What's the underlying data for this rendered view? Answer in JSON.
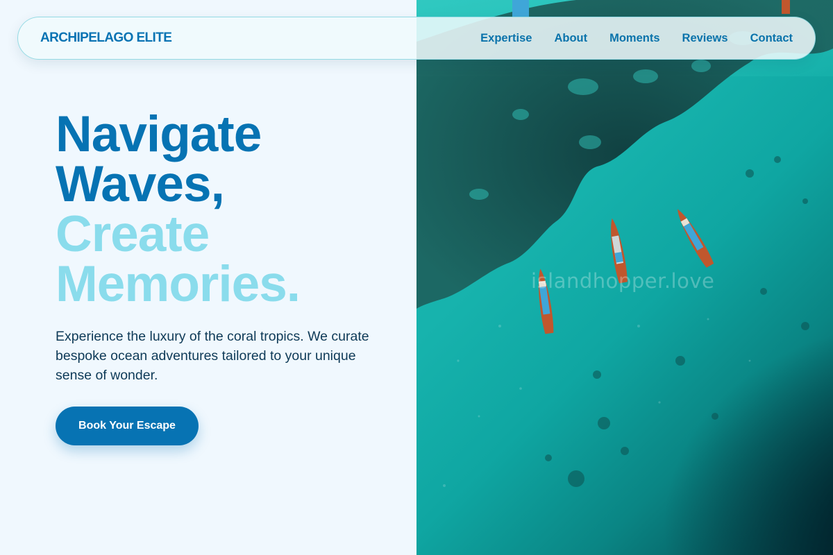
{
  "brand": {
    "name": "ARCHIPELAGO ELITE"
  },
  "nav": {
    "links": [
      {
        "label": "Expertise"
      },
      {
        "label": "About"
      },
      {
        "label": "Moments"
      },
      {
        "label": "Reviews"
      },
      {
        "label": "Contact"
      }
    ]
  },
  "hero": {
    "headline_dark_1": "Navigate",
    "headline_dark_2": "Waves,",
    "headline_light_1": "Create",
    "headline_light_2": "Memories.",
    "description": "Experience the luxury of the coral tropics. We curate bespoke ocean adventures tailored to your unique sense of wonder.",
    "cta_label": "Book Your Escape"
  },
  "image": {
    "watermark": "islandhopper.love",
    "subject_icons": [
      "longtail-boat-icon",
      "coral-reef",
      "turquoise-water"
    ]
  },
  "colors": {
    "primary": "#0773b3",
    "accent_light": "#8adcec",
    "background": "#f0f8fe",
    "text": "#0e3a57",
    "water": "#17b3ad"
  }
}
